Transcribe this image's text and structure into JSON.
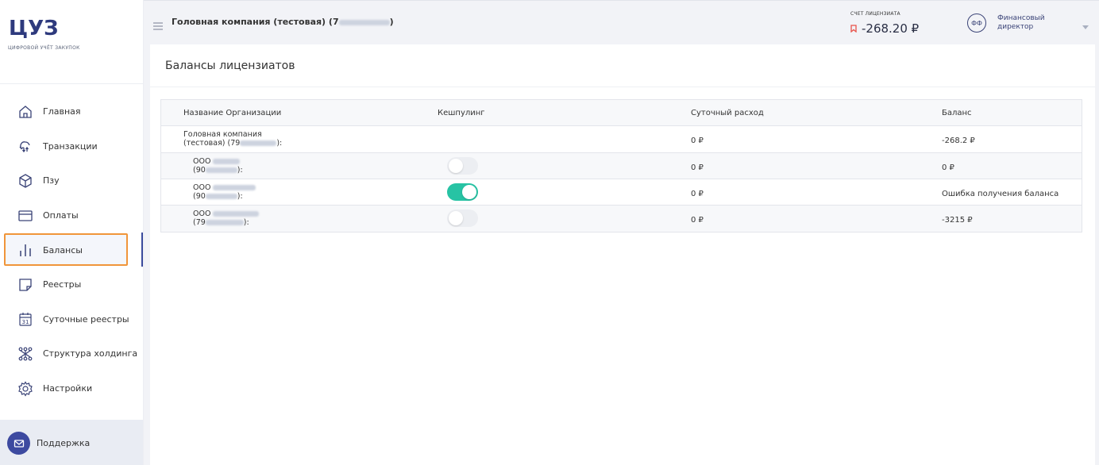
{
  "app": {
    "logo": "ЦУЗ",
    "logo_subtitle": "цифровой учёт закупок"
  },
  "sidebar": {
    "items": [
      {
        "label": "Главная",
        "icon": "home-icon"
      },
      {
        "label": "Транзакции",
        "icon": "transactions-icon"
      },
      {
        "label": "Пзу",
        "icon": "box-icon"
      },
      {
        "label": "Оплаты",
        "icon": "card-icon"
      },
      {
        "label": "Балансы",
        "icon": "bar-chart-icon",
        "active": true
      },
      {
        "label": "Реестры",
        "icon": "note-icon"
      },
      {
        "label": "Суточные реестры",
        "icon": "calendar-icon"
      },
      {
        "label": "Структура холдинга",
        "icon": "structure-icon"
      },
      {
        "label": "Настройки",
        "icon": "gear-icon"
      }
    ],
    "calendar_day": "31",
    "support_label": "Поддержка"
  },
  "header": {
    "company": "Головная компания (тестовая) (7",
    "company_end": ")",
    "account_caption": "СЧЕТ ЛИЦЕНЗИАТА",
    "account_value": "-268.20 ₽",
    "avatar_initials": "ФФ",
    "role": "Финансовый директор"
  },
  "page": {
    "title": "Балансы лицензиатов"
  },
  "table": {
    "columns": [
      "Название Организации",
      "Кешпулинг",
      "Суточный расход",
      "Баланс"
    ],
    "rows": [
      {
        "org_line1": "Головная компания",
        "org_line2_prefix": "(тестовая) (79",
        "org_line2_suffix": "):",
        "cashpooling": null,
        "daily": "0 ₽",
        "balance": "-268.2 ₽"
      },
      {
        "org_line1": "ООО",
        "org_line2_prefix": "(90",
        "org_line2_suffix": "):",
        "cashpooling": false,
        "daily": "0 ₽",
        "balance": "0 ₽"
      },
      {
        "org_line1": "ООО",
        "org_line2_prefix": "(90",
        "org_line2_suffix": "):",
        "cashpooling": true,
        "daily": "0 ₽",
        "balance": "Ошибка получения баланса"
      },
      {
        "org_line1": "ООО",
        "org_line2_prefix": "(79",
        "org_line2_suffix": "):",
        "cashpooling": false,
        "daily": "0 ₽",
        "balance": "-3215 ₽"
      }
    ]
  },
  "colors": {
    "brand": "#2e3a7d",
    "accent": "#3d4aa0",
    "toggle_on": "#27c3a4",
    "highlight": "#f0953a",
    "warning": "#e8524a"
  }
}
